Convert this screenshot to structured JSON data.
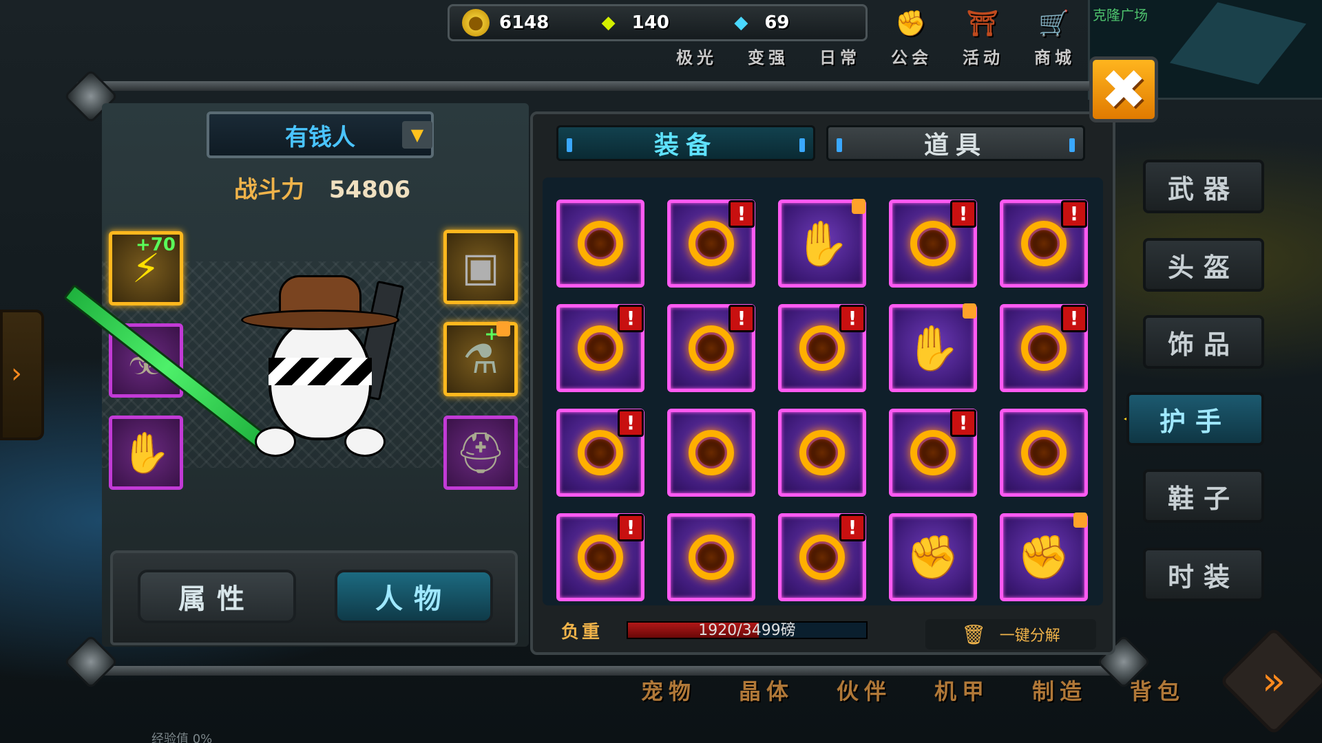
{
  "resources": [
    {
      "name": "gold",
      "icon": "gold-coin-icon",
      "value": "6148"
    },
    {
      "name": "yellow-gem",
      "icon": "yellow-gem-icon",
      "value": "140"
    },
    {
      "name": "blue-diamond",
      "icon": "diamond-icon",
      "value": "69"
    }
  ],
  "top_nav": [
    {
      "id": "aurora",
      "label": "极光",
      "icon": "aurora-icon"
    },
    {
      "id": "strengthen",
      "label": "变强",
      "icon": "strengthen-icon"
    },
    {
      "id": "daily",
      "label": "日常",
      "icon": "daily-icon"
    },
    {
      "id": "guild",
      "label": "公会",
      "icon": "fist-icon"
    },
    {
      "id": "event",
      "label": "活动",
      "icon": "gift-icon"
    },
    {
      "id": "shop",
      "label": "商城",
      "icon": "basket-icon"
    }
  ],
  "minimap": {
    "title": "克隆广场"
  },
  "character": {
    "name": "有钱人",
    "power_label": "战斗力",
    "power_value": "54806",
    "weapon_bonus": "+70"
  },
  "bottom_tabs": {
    "attributes": "属性",
    "character": "人物"
  },
  "inventory": {
    "tab_equip": "装备",
    "tab_items": "道具",
    "items": [
      {
        "type": "ring",
        "alert": false,
        "lock": false
      },
      {
        "type": "ring",
        "alert": true,
        "lock": false
      },
      {
        "type": "gauntlet",
        "alert": false,
        "lock": true
      },
      {
        "type": "ring",
        "alert": true,
        "lock": false
      },
      {
        "type": "ring",
        "alert": true,
        "lock": false
      },
      {
        "type": "ring",
        "alert": true,
        "lock": false
      },
      {
        "type": "ring",
        "alert": true,
        "lock": false
      },
      {
        "type": "ring",
        "alert": true,
        "lock": false
      },
      {
        "type": "gauntlet",
        "alert": false,
        "lock": true
      },
      {
        "type": "ring",
        "alert": true,
        "lock": false
      },
      {
        "type": "ring",
        "alert": true,
        "lock": false
      },
      {
        "type": "ring",
        "alert": false,
        "lock": false
      },
      {
        "type": "ring",
        "alert": false,
        "lock": false
      },
      {
        "type": "ring",
        "alert": true,
        "lock": false
      },
      {
        "type": "ring",
        "alert": false,
        "lock": false
      },
      {
        "type": "ring",
        "alert": true,
        "lock": false
      },
      {
        "type": "ring",
        "alert": false,
        "lock": false
      },
      {
        "type": "ring",
        "alert": true,
        "lock": false
      },
      {
        "type": "fist",
        "alert": false,
        "lock": false
      },
      {
        "type": "fist",
        "alert": false,
        "lock": true
      }
    ],
    "weight_label": "负重",
    "weight_text": "1920/3499磅",
    "weight_fraction": 0.549,
    "decompose_label": "一键分解"
  },
  "side_tabs": [
    {
      "id": "weapon",
      "label": "武器",
      "active": false
    },
    {
      "id": "helmet",
      "label": "头盔",
      "active": false
    },
    {
      "id": "accessory",
      "label": "饰品",
      "active": false
    },
    {
      "id": "gloves",
      "label": "护手",
      "active": true
    },
    {
      "id": "shoes",
      "label": "鞋子",
      "active": false
    },
    {
      "id": "fashion",
      "label": "时装",
      "active": false
    }
  ],
  "bottom_nav": [
    "宠物",
    "晶体",
    "伙伴",
    "机甲",
    "制造",
    "背包"
  ],
  "exp_text": "经验值 0%",
  "colors": {
    "accent": "#5fe2ff",
    "item_border": "#ff5af2",
    "gold_border": "#ffb81e",
    "alert": "#c81010",
    "close": "#ffb51e"
  }
}
